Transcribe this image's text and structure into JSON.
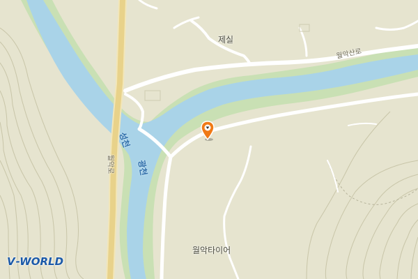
{
  "map": {
    "labels": {
      "village": "제실",
      "road_top": "월악산로",
      "road_left": "월악로",
      "river_1": "성천",
      "river_2": "광천",
      "business": "월악타이어"
    },
    "logo": {
      "mark": "V",
      "text": "-WORLD"
    },
    "marker_icon": "map-pin-icon",
    "colors": {
      "land": "#e6e4cf",
      "water": "#a9d3e8",
      "riverbank": "#c9e0b4",
      "road": "#ffffff",
      "contour": "#c8c5a8",
      "marker": "#f07a16"
    }
  }
}
